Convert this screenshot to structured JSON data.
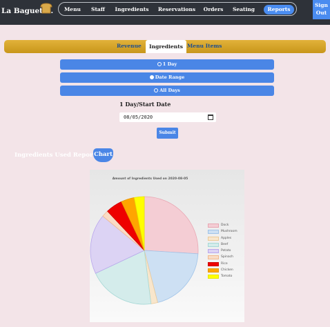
{
  "navbar": {
    "brand": "La Baguette.",
    "items": [
      "Menu",
      "Staff",
      "Ingredients",
      "Reservations",
      "Orders",
      "Seating",
      "Reports"
    ],
    "active_item": "Reports",
    "signout": "Sign Out"
  },
  "tabs": {
    "items": [
      "Revenue",
      "Ingredients",
      "Menu Items"
    ],
    "active": "Ingredients"
  },
  "filters": {
    "options": [
      "1 Day",
      "Date Range",
      "All Days"
    ],
    "selected": "Date Range"
  },
  "date": {
    "label": "1 Day/Start Date",
    "value": "08/05/2020"
  },
  "submit_label": "Submit",
  "report": {
    "title": "Ingredients Used Report",
    "badge": "Chart"
  },
  "colors": {
    "navbar": "#2e3239",
    "accent_blue": "#4a86e6",
    "tab_gold": "#d6a52a",
    "page_bg": "#f3e4e8"
  },
  "chart_data": {
    "type": "pie",
    "title": "Amount of Ingredients Used on 2020-08-05",
    "legend_position": "right",
    "slices": [
      {
        "label": "Dock",
        "value": 26,
        "color": "#f4cdd4",
        "stroke": "#e8a6b2"
      },
      {
        "label": "Mushroom",
        "value": 20,
        "color": "#cde0f3",
        "stroke": "#9fc3e8"
      },
      {
        "label": "Apples",
        "value": 2,
        "color": "#f8e6cc",
        "stroke": "#ecca98"
      },
      {
        "label": "Beef",
        "value": 20,
        "color": "#d4eceb",
        "stroke": "#a6d8d6"
      },
      {
        "label": "Potato",
        "value": 18,
        "color": "#dcd3f4",
        "stroke": "#b9a6ec"
      },
      {
        "label": "Spinach",
        "value": 2,
        "color": "#f9dcc5",
        "stroke": "#f2b98e"
      },
      {
        "label": "Rice",
        "value": 5,
        "color": "#ee0000",
        "stroke": "#cc0000"
      },
      {
        "label": "Chicken",
        "value": 4,
        "color": "#ffa500",
        "stroke": "#e69500"
      },
      {
        "label": "Tomato",
        "value": 3,
        "color": "#ffff00",
        "stroke": "#e6e600"
      }
    ]
  }
}
